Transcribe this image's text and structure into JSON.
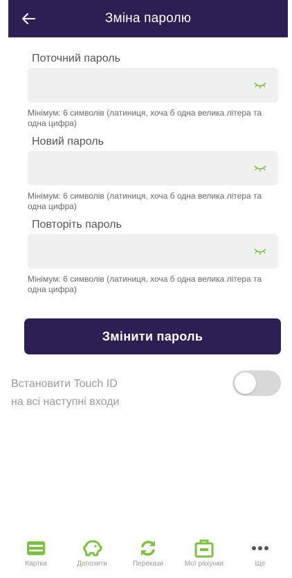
{
  "header": {
    "title": "Зміна паролю",
    "back_icon": "arrow-left-icon"
  },
  "form": {
    "current_password": {
      "label": "Поточний пароль",
      "value": "",
      "hint": "Мінімум: 6 символів (латиниця, хоча б одна велика літера та одна цифра)",
      "icon": "eye-closed-icon"
    },
    "new_password": {
      "label": "Новий пароль",
      "value": "",
      "hint": "Мінімум: 6 символів (латиниця, хоча б одна велика літера та одна цифра)",
      "icon": "eye-closed-icon"
    },
    "repeat_password": {
      "label": "Повторіть пароль",
      "value": "",
      "hint": "Мінімум: 6 символів (латиниця, хоча б одна велика літера та одна цифра)",
      "icon": "eye-closed-icon"
    },
    "submit_label": "Змінити пароль"
  },
  "touch_id": {
    "label_line1": "Встановити Touch ID",
    "label_line2": "на всі наступні входи",
    "enabled": false
  },
  "tabbar": {
    "items": [
      {
        "label": "Картки",
        "icon": "card-icon"
      },
      {
        "label": "Депозити",
        "icon": "piggy-bank-icon"
      },
      {
        "label": "Перекази",
        "icon": "refresh-icon"
      },
      {
        "label": "Мої рахунки",
        "icon": "briefcase-icon"
      },
      {
        "label": "Ще",
        "icon": "more-dots-icon"
      }
    ]
  },
  "colors": {
    "primary": "#2b1f54",
    "accent_green": "#7cc242",
    "field_bg": "#f0f0f0",
    "toggle_off": "#d8d8d8"
  }
}
